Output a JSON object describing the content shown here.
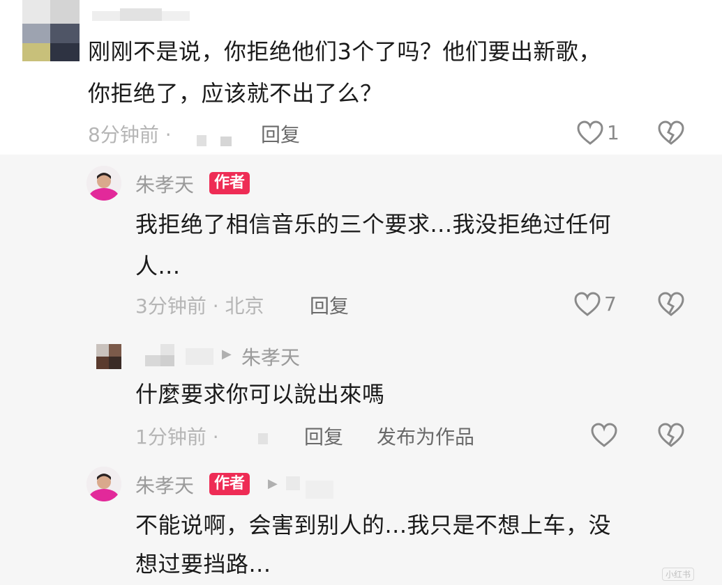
{
  "comment": {
    "text_line1": "刚刚不是说，你拒绝他们3个了吗？他们要出新歌，",
    "text_line2": "你拒绝了，应该就不出了么？",
    "time": "8分钟前 ·",
    "reply_label": "回复",
    "like_count": "1"
  },
  "reply1": {
    "author": "朱孝天",
    "badge": "作者",
    "text_line1": "我拒绝了相信音乐的三个要求...我没拒绝过任何",
    "text_line2": "人...",
    "time": "3分钟前 · 北京",
    "reply_label": "回复",
    "like_count": "7"
  },
  "reply2": {
    "target": "朱孝天",
    "text": "什麼要求你可以說出來嗎",
    "time": "1分钟前 ·",
    "reply_label": "回复",
    "publish_label": "发布为作品"
  },
  "reply3": {
    "author": "朱孝天",
    "badge": "作者",
    "text_line1": "不能说啊，会害到别人的...我只是不想上车，没",
    "text_line2": "想过要挡路..."
  },
  "watermark": "小红书",
  "icons": {
    "like": "heart-outline-icon",
    "dislike": "broken-heart-icon",
    "arrow": "play-arrow-icon"
  },
  "colors": {
    "badge_bg": "#ee2c55",
    "text": "#1a1a1a",
    "meta": "#b5b5b5",
    "reply_area_bg": "#f6f6f6"
  }
}
